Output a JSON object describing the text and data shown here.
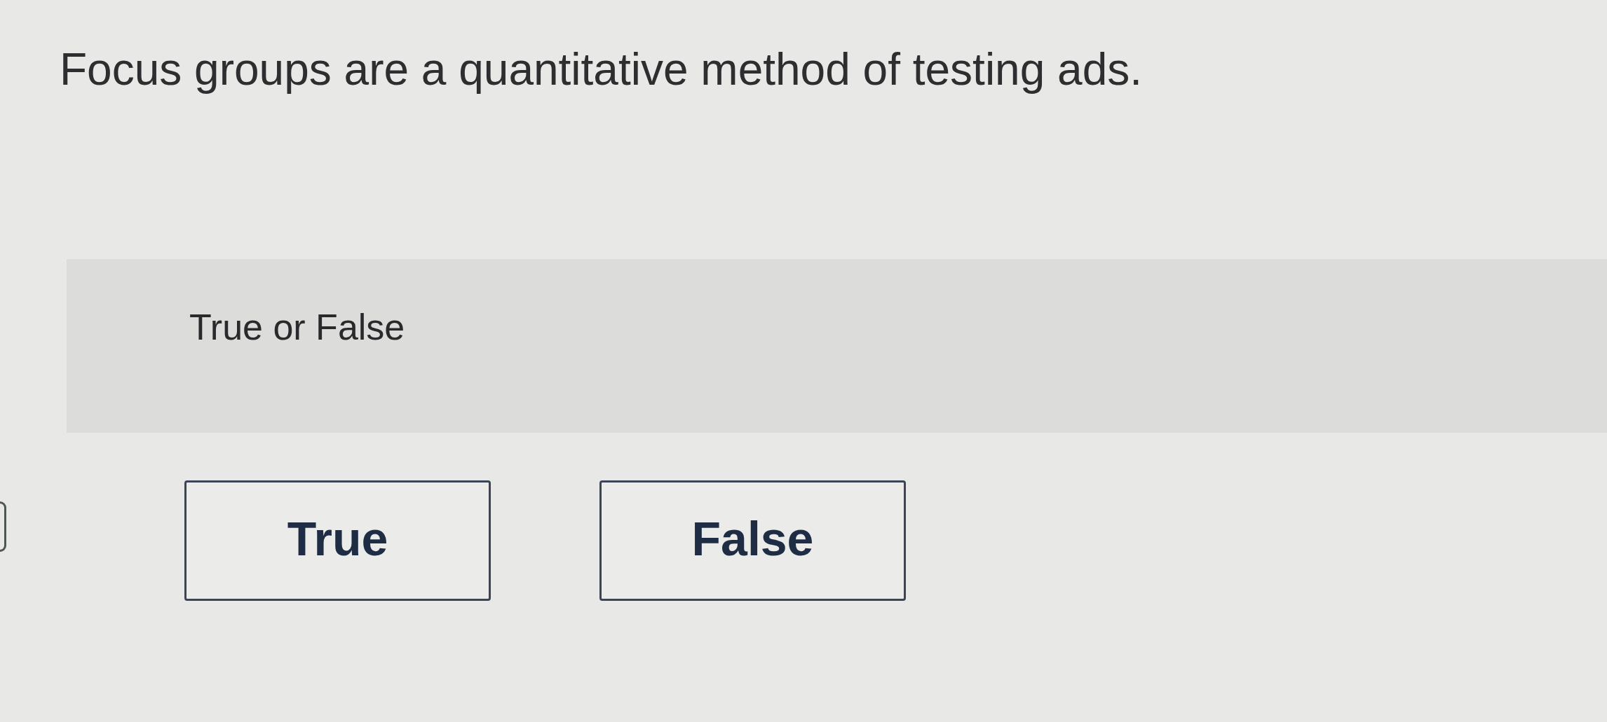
{
  "question": {
    "text": "Focus groups are a quantitative method of testing ads."
  },
  "prompt": {
    "text": "True or False"
  },
  "answers": [
    {
      "label": "True",
      "selected": false
    },
    {
      "label": "False",
      "selected": false
    }
  ]
}
